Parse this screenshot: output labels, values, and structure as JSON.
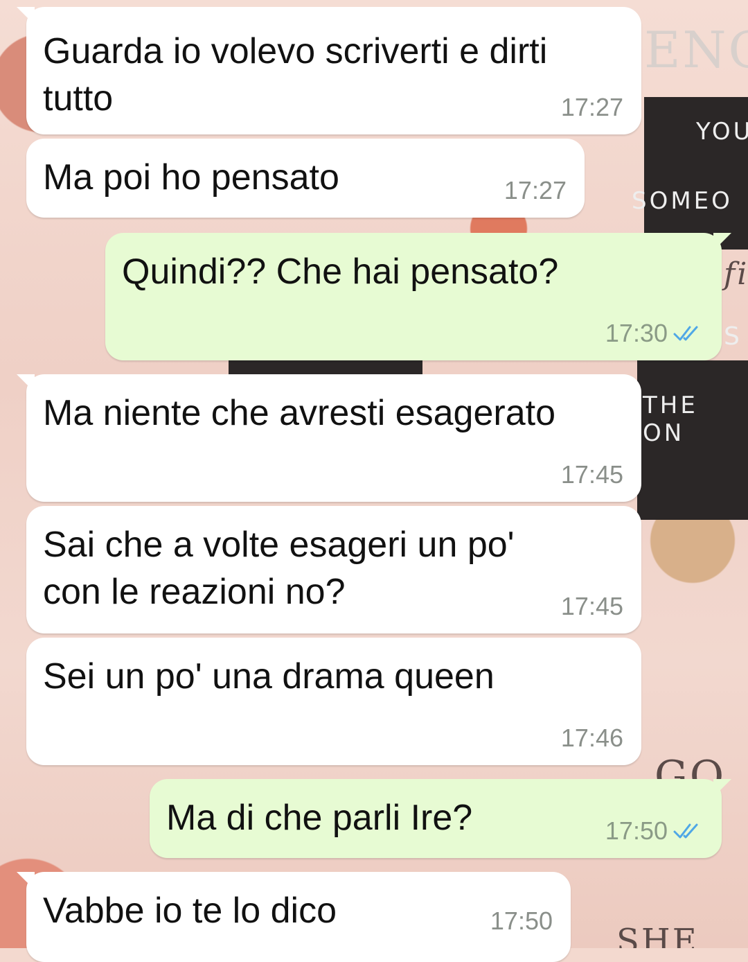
{
  "messages": [
    {
      "direction": "in",
      "text": "Guarda io volevo scriverti e dirti\ntutto",
      "time": "17:27"
    },
    {
      "direction": "in",
      "text": "Ma poi ho pensato",
      "time": "17:27"
    },
    {
      "direction": "out",
      "text": "Quindi?? Che hai pensato?",
      "time": "17:30",
      "status": "read"
    },
    {
      "direction": "in",
      "text": "Ma niente che avresti esagerato",
      "time": "17:45"
    },
    {
      "direction": "in",
      "text": "Sai che a volte esageri un po'\ncon le reazioni no?",
      "time": "17:45"
    },
    {
      "direction": "in",
      "text": "Sei un po' una drama queen",
      "time": "17:46"
    },
    {
      "direction": "out",
      "text": "Ma di che parli Ire?",
      "time": "17:50",
      "status": "read"
    },
    {
      "direction": "in",
      "text": "Vabbe io te lo dico",
      "time": "17:50"
    }
  ],
  "wallpaper": {
    "fragments": [
      "ENG",
      "YOU",
      "SOMEO",
      "THE ON",
      "GO",
      "SHE",
      "fi",
      "S"
    ]
  },
  "colors": {
    "incoming_bubble": "#ffffff",
    "outgoing_bubble": "#e7fbd3",
    "read_ticks": "#4fa7e6",
    "timestamp": "#8a8f8a"
  }
}
